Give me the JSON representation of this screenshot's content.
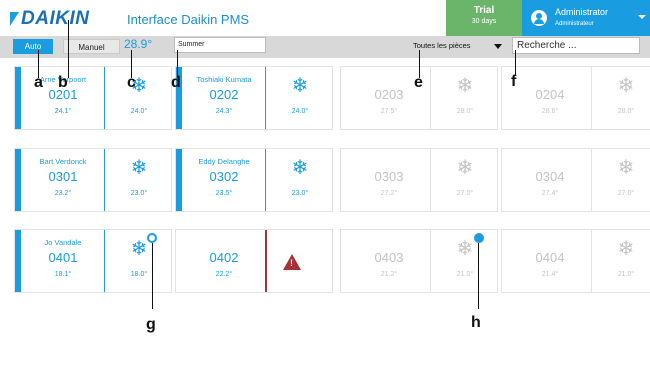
{
  "header": {
    "logo_text": "DAIKIN",
    "app_title": "Interface Daikin PMS",
    "trial_label": "Trial",
    "trial_days": "30 days",
    "user_name": "Administrator",
    "user_role": "Administrateur"
  },
  "toolbar": {
    "auto_label": "Auto",
    "manuel_label": "Manuel",
    "setpoint": "28.9°",
    "mode_value": "Summer",
    "rooms_filter": "Toutes les pièces",
    "search_placeholder": "Recherche ..."
  },
  "rooms": [
    {
      "occupant": "Arne Verpoort",
      "room": "0201",
      "temp": "24.1°",
      "setpoint": "24.0°",
      "state": "active"
    },
    {
      "occupant": "Toshiaki Kumata",
      "room": "0202",
      "temp": "24.3°",
      "setpoint": "24.0°",
      "state": "active"
    },
    {
      "occupant": "",
      "room": "0203",
      "temp": "27.5°",
      "setpoint": "28.0°",
      "state": "inactive"
    },
    {
      "occupant": "",
      "room": "0204",
      "temp": "28.6°",
      "setpoint": "28.0°",
      "state": "inactive"
    },
    {
      "occupant": "Bart Verdonck",
      "room": "0301",
      "temp": "23.2°",
      "setpoint": "23.0°",
      "state": "active"
    },
    {
      "occupant": "Eddy Delanghe",
      "room": "0302",
      "temp": "23.5°",
      "setpoint": "23.0°",
      "state": "active"
    },
    {
      "occupant": "",
      "room": "0303",
      "temp": "27.2°",
      "setpoint": "27.0°",
      "state": "inactive"
    },
    {
      "occupant": "",
      "room": "0304",
      "temp": "27.4°",
      "setpoint": "27.0°",
      "state": "inactive"
    },
    {
      "occupant": "Jo Vandale",
      "room": "0401",
      "temp": "18.1°",
      "setpoint": "18.0°",
      "state": "active"
    },
    {
      "occupant": "",
      "room": "0402",
      "temp": "22.2°",
      "setpoint": "",
      "state": "alarm"
    },
    {
      "occupant": "",
      "room": "0403",
      "temp": "21.2°",
      "setpoint": "21.0°",
      "state": "inactive"
    },
    {
      "occupant": "",
      "room": "0404",
      "temp": "21.4°",
      "setpoint": "21.0°",
      "state": "inactive"
    }
  ],
  "icons": {
    "snowflake": "❄",
    "warning": "!"
  },
  "callouts": {
    "a": "a",
    "b": "b",
    "c": "c",
    "d": "d",
    "e": "e",
    "f": "f",
    "g": "g",
    "h": "h"
  },
  "colors": {
    "accent": "#1a9de0",
    "trial": "#6ab56a",
    "alarm": "#a93232",
    "inactive": "#c4c4c4"
  }
}
